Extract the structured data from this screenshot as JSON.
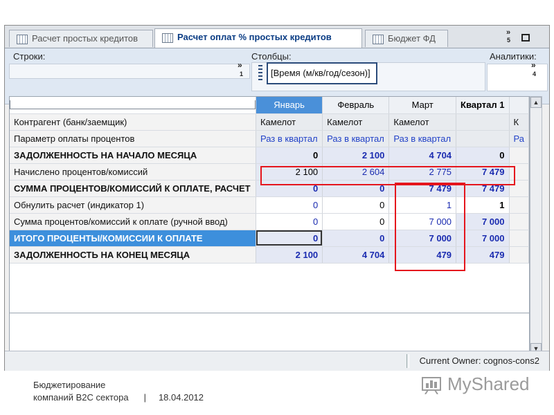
{
  "tabs": [
    {
      "label": "Расчет простых кредитов",
      "active": false
    },
    {
      "label": "Расчет оплат % простых кредитов",
      "active": true
    },
    {
      "label": "Бюджет ФД",
      "active": false
    }
  ],
  "window_controls": {
    "more_glyph": "»",
    "more_count": "5",
    "maximize_glyph": "□",
    "close_glyph": "×"
  },
  "dimensions": {
    "rows_label": "Строки:",
    "rows_more": "»",
    "rows_count": "1",
    "columns_label": "Столбцы:",
    "columns_chip": "[Время (м/кв/год/сезон)]",
    "analytics_label": "Аналитики:",
    "analytics_more": "»",
    "analytics_count": "4"
  },
  "grid": {
    "columns": [
      "Январь",
      "Февраль",
      "Март",
      "Квартал 1",
      "К"
    ],
    "selected_column": "Январь",
    "rows": [
      {
        "label": "Контрагент (банк/заемщик)",
        "style": "normal",
        "cells": [
          "Камелот",
          "Камелот",
          "Камелот",
          "",
          "К"
        ]
      },
      {
        "label": "Параметр оплаты процентов",
        "style": "normal",
        "cells": [
          "Раз в квартал",
          "Раз в квартал",
          "Раз в квартал",
          "",
          "Ра"
        ]
      },
      {
        "label": "ЗАДОЛЖЕННОСТЬ НА НАЧАЛО МЕСЯЦА",
        "style": "bold",
        "cells": [
          "0",
          "2 100",
          "4 704",
          "0",
          ""
        ]
      },
      {
        "label": "Начислено процентов/комиссий",
        "style": "normal",
        "cells": [
          "2 100",
          "2 604",
          "2 775",
          "7 479",
          ""
        ]
      },
      {
        "label": "СУММА ПРОЦЕНТОВ/КОМИССИЙ К ОПЛАТЕ, РАСЧЕТ",
        "style": "bold",
        "cells": [
          "0",
          "0",
          "7 479",
          "7 479",
          ""
        ]
      },
      {
        "label": "Обнулить расчет (индикатор 1)",
        "style": "normal",
        "cells": [
          "0",
          "0",
          "1",
          "1",
          ""
        ]
      },
      {
        "label": "Сумма процентов/комиссий к оплате (ручной ввод)",
        "style": "normal",
        "cells": [
          "0",
          "0",
          "7 000",
          "7 000",
          ""
        ]
      },
      {
        "label": "ИТОГО ПРОЦЕНТЫ/КОМИССИИ К ОПЛАТЕ",
        "style": "selected",
        "cells": [
          "0",
          "0",
          "7 000",
          "7 000",
          ""
        ]
      },
      {
        "label": "ЗАДОЛЖЕННОСТЬ НА КОНЕЦ МЕСЯЦА",
        "style": "bold",
        "cells": [
          "2 100",
          "4 704",
          "479",
          "479",
          ""
        ]
      }
    ]
  },
  "status": {
    "owner": "Current Owner: cognos-cons2"
  },
  "footer": {
    "line1": "Бюджетирование",
    "line2": "компаний B2C сектора",
    "separator": "|",
    "date": "18.04.2012"
  },
  "logo": {
    "text": "MyShared"
  },
  "colors": {
    "highlight_red": "#e5151c",
    "selected_blue": "#3d8fdc",
    "value_blue": "#1a2bb0"
  }
}
